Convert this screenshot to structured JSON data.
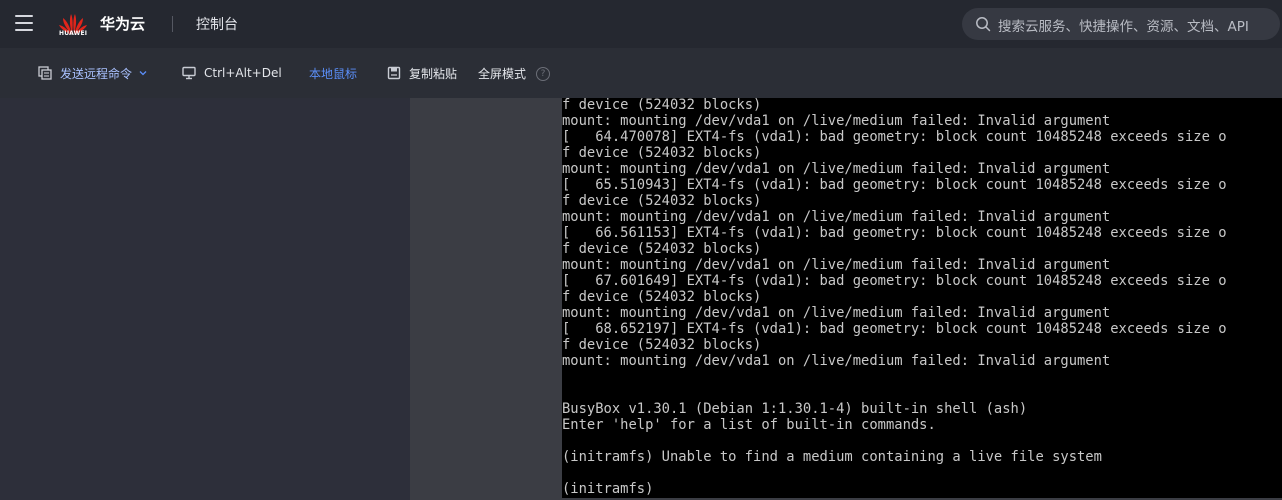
{
  "header": {
    "logo_text": "HUAWEI",
    "brand": "华为云",
    "console_title": "控制台",
    "search_placeholder": "搜索云服务、快捷操作、资源、文档、API"
  },
  "toolbar": {
    "send_command_label": "发送远程命令",
    "ctrl_alt_del_label": "Ctrl+Alt+Del",
    "local_mouse_label": "本地鼠标",
    "copy_paste_label": "复制粘贴",
    "fullscreen_label": "全屏模式",
    "help_glyph": "?"
  },
  "colors": {
    "accent": "#5b8ff9",
    "topbar": "#252830",
    "toolbar": "#2b2e36",
    "terminal_bg": "#000000",
    "terminal_fg": "#c8c8c8",
    "logo_red": "#e1251b"
  },
  "icons": [
    "menu-icon",
    "huawei-logo",
    "search-icon",
    "command-icon",
    "chevron-down-icon",
    "monitor-icon",
    "clipboard-icon",
    "help-icon"
  ],
  "terminal": {
    "lines": [
      "f device (524032 blocks)",
      "mount: mounting /dev/vda1 on /live/medium failed: Invalid argument",
      "[   64.470078] EXT4-fs (vda1): bad geometry: block count 10485248 exceeds size o",
      "f device (524032 blocks)",
      "mount: mounting /dev/vda1 on /live/medium failed: Invalid argument",
      "[   65.510943] EXT4-fs (vda1): bad geometry: block count 10485248 exceeds size o",
      "f device (524032 blocks)",
      "mount: mounting /dev/vda1 on /live/medium failed: Invalid argument",
      "[   66.561153] EXT4-fs (vda1): bad geometry: block count 10485248 exceeds size o",
      "f device (524032 blocks)",
      "mount: mounting /dev/vda1 on /live/medium failed: Invalid argument",
      "[   67.601649] EXT4-fs (vda1): bad geometry: block count 10485248 exceeds size o",
      "f device (524032 blocks)",
      "mount: mounting /dev/vda1 on /live/medium failed: Invalid argument",
      "[   68.652197] EXT4-fs (vda1): bad geometry: block count 10485248 exceeds size o",
      "f device (524032 blocks)",
      "mount: mounting /dev/vda1 on /live/medium failed: Invalid argument",
      "",
      "",
      "BusyBox v1.30.1 (Debian 1:1.30.1-4) built-in shell (ash)",
      "Enter 'help' for a list of built-in commands.",
      "",
      "(initramfs) Unable to find a medium containing a live file system",
      "",
      "(initramfs)"
    ]
  }
}
